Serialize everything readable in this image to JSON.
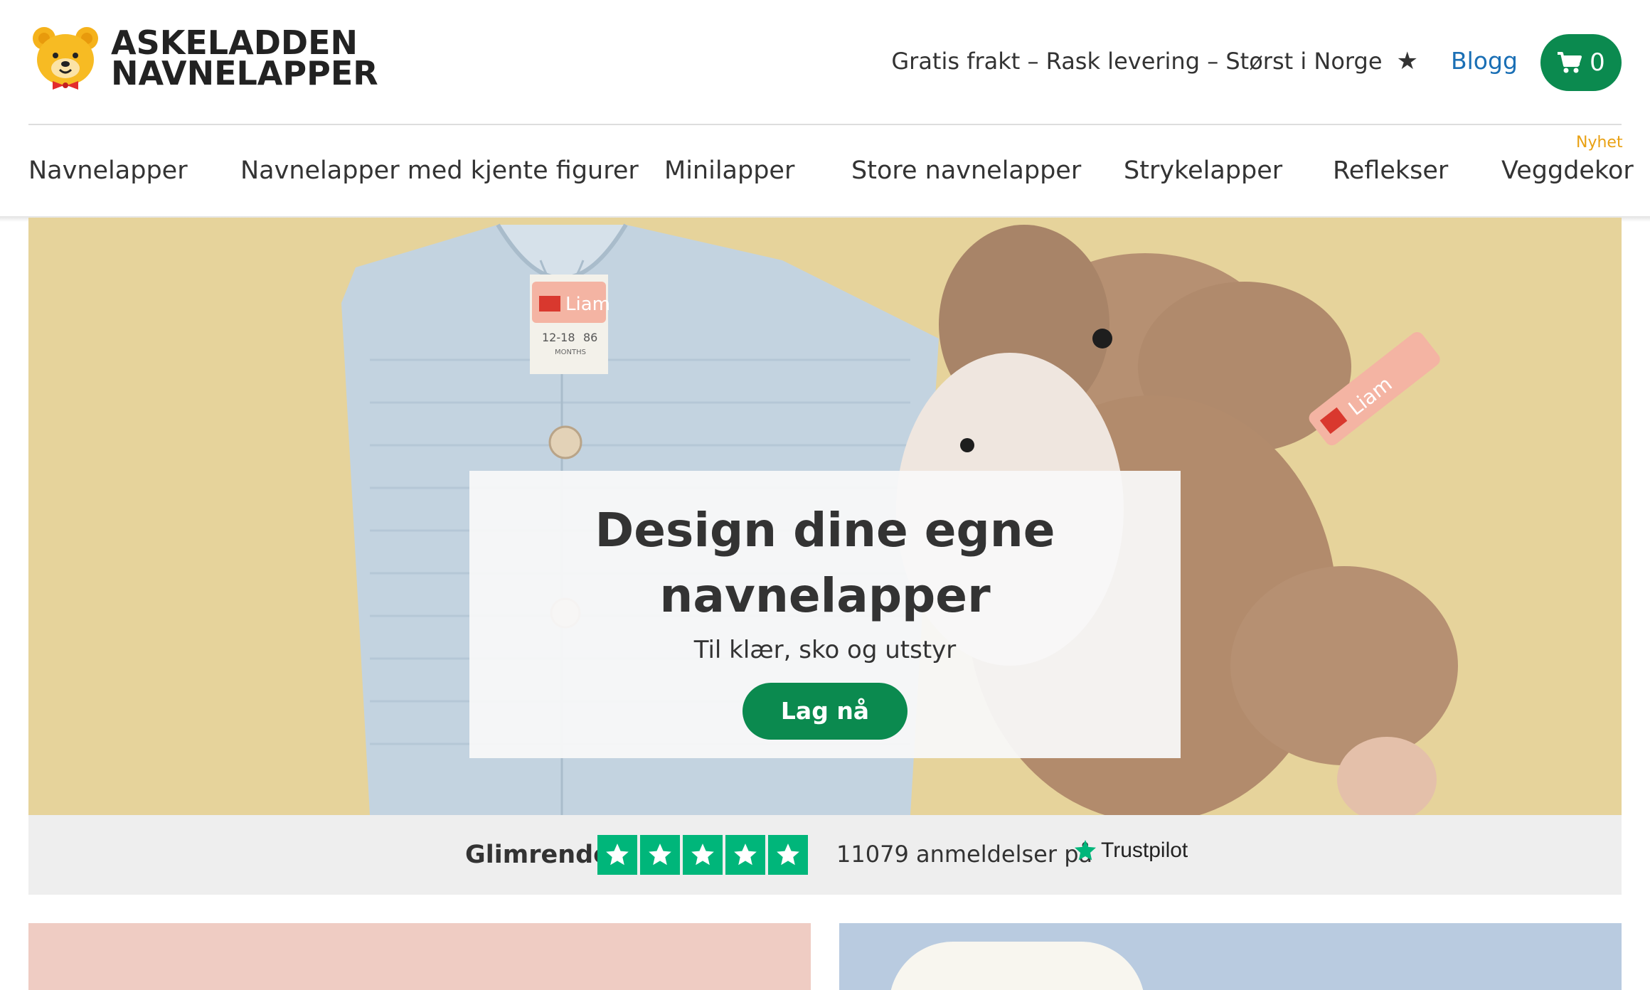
{
  "brand": {
    "line1": "ASKELADDEN",
    "line2": "NAVNELAPPER",
    "logo_icon": "bear-icon"
  },
  "header": {
    "tagline": "Gratis frakt – Rask levering – Størst i Norge",
    "blog_label": "Blogg",
    "cart_count": "0"
  },
  "nav": {
    "items": [
      {
        "label": "Navnelapper"
      },
      {
        "label": "Navnelapper med kjente figurer"
      },
      {
        "label": "Minilapper"
      },
      {
        "label": "Store navnelapper"
      },
      {
        "label": "Strykelapper"
      },
      {
        "label": "Reflekser"
      },
      {
        "label": "Veggdekor",
        "badge": "Nyhet"
      }
    ]
  },
  "hero": {
    "title_line1": "Design dine egne",
    "title_line2": "navnelapper",
    "subtitle": "Til klær, sko og utstyr",
    "button": "Lag nå",
    "label_name": "Liam",
    "size_text": "12-18",
    "size_cm": "86",
    "months": "MONTHS"
  },
  "trust": {
    "rating_label": "Glimrende",
    "stars": 5,
    "count_text": "11079 anmeldelser på",
    "provider": "Trustpilot"
  },
  "colors": {
    "primary": "#0b8a4f",
    "link": "#1a6fb5",
    "badge": "#e9a114",
    "trustpilot": "#00b67a",
    "hero_bg": "#e6d39b"
  }
}
